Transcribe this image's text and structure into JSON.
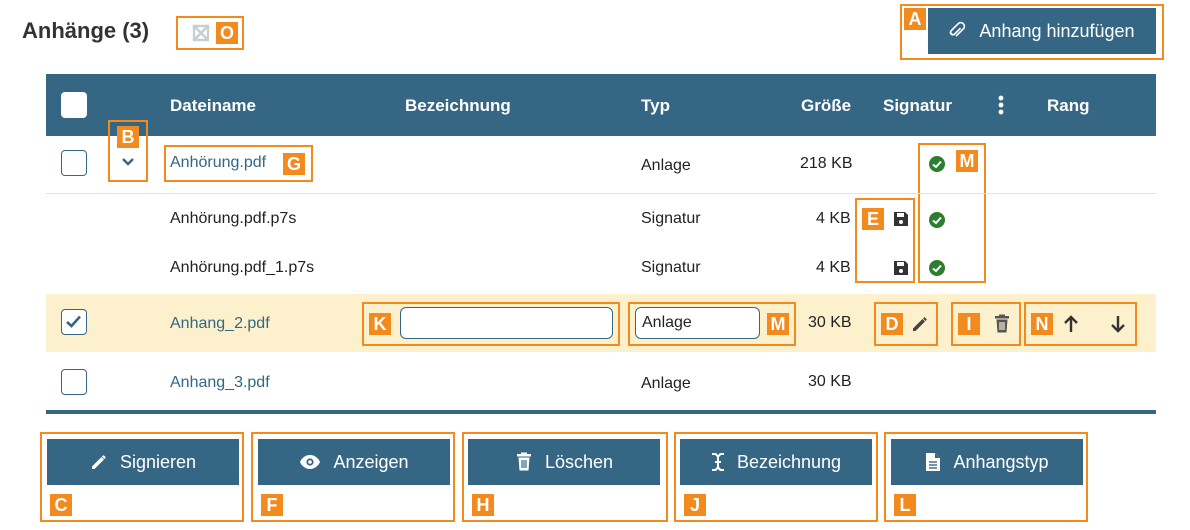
{
  "header": {
    "title": "Anhänge (3)",
    "add_button_label": "Anhang hinzufügen"
  },
  "columns": {
    "filename": "Dateiname",
    "label": "Bezeichnung",
    "type": "Typ",
    "size": "Größe",
    "signature": "Signatur",
    "rank": "Rang"
  },
  "rows": [
    {
      "filename": "Anhörung.pdf",
      "type": "Anlage",
      "size": "218 KB",
      "signed": true,
      "checked": false
    },
    {
      "filename": "Anhörung.pdf.p7s",
      "type": "Signatur",
      "size": "4 KB",
      "signed": true
    },
    {
      "filename": "Anhörung.pdf_1.p7s",
      "type": "Signatur",
      "size": "4 KB",
      "signed": true
    },
    {
      "filename": "Anhang_2.pdf",
      "label_value": "",
      "type_value": "Anlage",
      "size": "30 KB",
      "checked": true
    },
    {
      "filename": "Anhang_3.pdf",
      "type": "Anlage",
      "size": "30 KB",
      "checked": false
    }
  ],
  "actions": {
    "sign": "Signieren",
    "view": "Anzeigen",
    "delete": "Löschen",
    "rename": "Bezeichnung",
    "type": "Anhangstyp"
  },
  "callouts": {
    "A": "A",
    "B": "B",
    "C": "C",
    "D": "D",
    "E": "E",
    "F": "F",
    "G": "G",
    "H": "H",
    "I": "I",
    "J": "J",
    "K": "K",
    "L": "L",
    "M": "M",
    "N": "N",
    "O": "O"
  },
  "colors": {
    "primary": "#356784",
    "callout": "#f28a1e",
    "success": "#2e7d32",
    "highlight": "#fcf1cc"
  }
}
